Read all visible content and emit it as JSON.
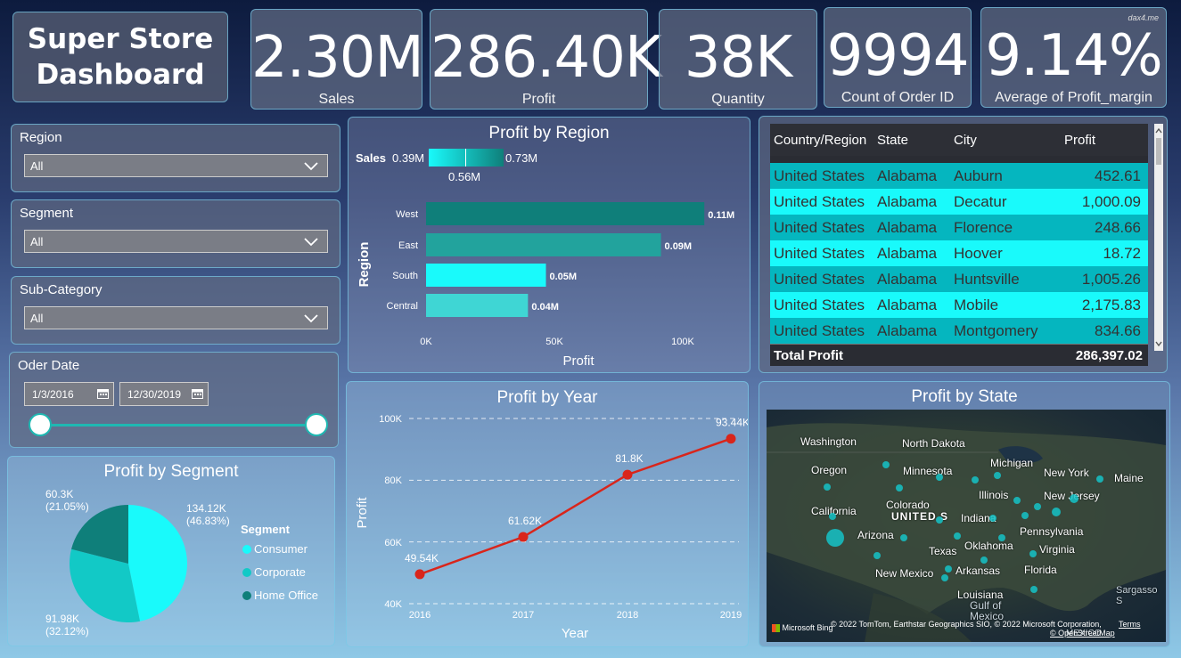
{
  "header": {
    "title_line1": "Super Store",
    "title_line2": "Dashboard",
    "watermark": "dax4.me"
  },
  "kpis": [
    {
      "value": "2.30M",
      "label": "Sales"
    },
    {
      "value": "286.40K",
      "label": "Profit"
    },
    {
      "value": "38K",
      "label": "Quantity"
    },
    {
      "value": "9994",
      "label": "Count of Order ID"
    },
    {
      "value": "9.14%",
      "label": "Average of Profit_margin"
    }
  ],
  "slicers": {
    "region": {
      "label": "Region",
      "value": "All"
    },
    "segment": {
      "label": "Segment",
      "value": "All"
    },
    "subcategory": {
      "label": "Sub-Category",
      "value": "All"
    },
    "order_date": {
      "label": "Oder Date",
      "start": "1/3/2016",
      "end": "12/30/2019"
    }
  },
  "profit_by_region": {
    "title": "Profit by Region",
    "legend_title": "Sales",
    "legend_min": "0.39M",
    "legend_max": "0.73M",
    "legend_mid": "0.56M",
    "ylabel": "Region",
    "xlabel": "Profit",
    "xticks": [
      "0K",
      "50K",
      "100K"
    ]
  },
  "table": {
    "columns": [
      "Country/Region",
      "State",
      "City",
      "Profit"
    ],
    "rows": [
      [
        "United States",
        "Alabama",
        "Auburn",
        "452.61"
      ],
      [
        "United States",
        "Alabama",
        "Decatur",
        "1,000.09"
      ],
      [
        "United States",
        "Alabama",
        "Florence",
        "248.66"
      ],
      [
        "United States",
        "Alabama",
        "Hoover",
        "18.72"
      ],
      [
        "United States",
        "Alabama",
        "Huntsville",
        "1,005.26"
      ],
      [
        "United States",
        "Alabama",
        "Mobile",
        "2,175.83"
      ],
      [
        "United States",
        "Alabama",
        "Montgomery",
        "834.66"
      ]
    ],
    "total_label": "Total Profit",
    "total_value": "286,397.02"
  },
  "profit_by_year": {
    "title": "Profit by Year",
    "ylabel": "Profit",
    "xlabel": "Year",
    "yticks": [
      "40K",
      "60K",
      "80K",
      "100K"
    ]
  },
  "profit_by_segment": {
    "title": "Profit by Segment",
    "legend_title": "Segment"
  },
  "profit_by_state": {
    "title": "Profit by State",
    "states": [
      "Washington",
      "North Dakota",
      "Oregon",
      "Minnesota",
      "Michigan",
      "New York",
      "Maine",
      "Illinois",
      "New Jersey",
      "California",
      "Colorado",
      "UNITED S",
      "Indiana",
      "Arizona",
      "Pennsylvania",
      "Texas",
      "Oklahoma",
      "Virginia",
      "New Mexico",
      "Arkansas",
      "Florida",
      "Louisiana",
      "Gulf of",
      "Mexico",
      "Sargasso S",
      "MEXICO"
    ],
    "attribution": "© 2022 TomTom, Earthstar Geographics SIO, © 2022 Microsoft Corporation,",
    "terms": "Terms",
    "osm": "© OpenStreetMap",
    "bing": "Microsoft Bing"
  },
  "colors": {
    "teal_dark": "#0f7f7a",
    "teal_mid": "#22a39d",
    "cyan": "#19fafb",
    "teal_light": "#3fd6d4",
    "line_red": "#d9251b"
  },
  "chart_data": [
    {
      "type": "bar",
      "title": "Profit by Region",
      "categories": [
        "West",
        "East",
        "South",
        "Central"
      ],
      "values": [
        108400,
        91500,
        46700,
        39700
      ],
      "value_labels": [
        "0.11M",
        "0.09M",
        "0.05M",
        "0.04M"
      ],
      "xlabel": "Profit",
      "ylabel": "Region",
      "xlim": [
        0,
        110000
      ],
      "colors": [
        "#0f7f7a",
        "#22a39d",
        "#19fafb",
        "#3fd6d4"
      ]
    },
    {
      "type": "line",
      "title": "Profit by Year",
      "x": [
        "2016",
        "2017",
        "2018",
        "2019"
      ],
      "values": [
        49540,
        61620,
        81800,
        93440
      ],
      "value_labels": [
        "49.54K",
        "61.62K",
        "81.8K",
        "93.44K"
      ],
      "xlabel": "Year",
      "ylabel": "Profit",
      "ylim": [
        40000,
        100000
      ]
    },
    {
      "type": "pie",
      "title": "Profit by Segment",
      "categories": [
        "Consumer",
        "Corporate",
        "Home Office"
      ],
      "values": [
        134120,
        91980,
        60300
      ],
      "value_labels": [
        "134.12K\n(46.83%)",
        "91.98K\n(32.12%)",
        "60.3K\n(21.05%)"
      ],
      "colors": [
        "#19fafb",
        "#12c9c6",
        "#0f7f7a"
      ]
    }
  ]
}
